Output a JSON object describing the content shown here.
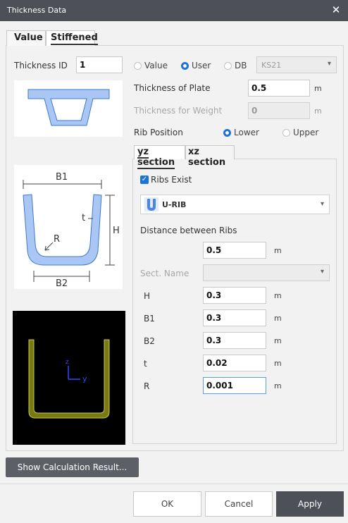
{
  "window": {
    "title": "Thickness Data",
    "close_glyph": "✕"
  },
  "tabs": {
    "value": "Value",
    "stiffened": "Stiffened"
  },
  "thickness_id": {
    "label": "Thickness ID",
    "value": "1"
  },
  "source": {
    "options": [
      {
        "label": "Value",
        "selected": false
      },
      {
        "label": "User",
        "selected": true
      },
      {
        "label": "DB",
        "selected": false
      }
    ],
    "db_select": "KS21"
  },
  "plate": {
    "label": "Thickness of Plate",
    "value": "0.5",
    "unit": "m"
  },
  "weight": {
    "label": "Thickness for Weight",
    "value": "0",
    "unit": "m"
  },
  "rib_position": {
    "label": "Rib Position",
    "options": [
      {
        "label": "Lower",
        "selected": true
      },
      {
        "label": "Upper",
        "selected": false
      }
    ]
  },
  "section_tabs": {
    "yz": "yz section",
    "xz": "xz section"
  },
  "ribs": {
    "exists_label": "Ribs Exist",
    "exists_checked": true,
    "type": "U-RIB",
    "distance_label": "Distance between Ribs",
    "distance_value": "0.5",
    "distance_unit": "m",
    "sect_name_label": "Sect. Name",
    "sect_name_value": "",
    "params": [
      {
        "name": "H",
        "value": "0.3",
        "unit": "m"
      },
      {
        "name": "B1",
        "value": "0.3",
        "unit": "m"
      },
      {
        "name": "B2",
        "value": "0.3",
        "unit": "m"
      },
      {
        "name": "t",
        "value": "0.02",
        "unit": "m"
      },
      {
        "name": "R",
        "value": "0.001",
        "unit": "m"
      }
    ]
  },
  "diagram": {
    "b1": "B1",
    "b2": "B2",
    "h": "H",
    "t": "t",
    "r": "R"
  },
  "preview": {
    "axis_z": "z",
    "axis_y": "y"
  },
  "buttons": {
    "calc": "Show Calculation Result...",
    "ok": "OK",
    "cancel": "Cancel",
    "apply": "Apply"
  },
  "colors": {
    "accent": "#1e73d8",
    "titlebar": "#4d5157",
    "rib_fill": "#a9c6f5",
    "preview_stroke": "#b5b53a"
  },
  "icons": {
    "close": "close-icon",
    "chevron": "chevron-down-icon",
    "u_rib": "u-rib-icon",
    "check": "checkbox-icon"
  }
}
